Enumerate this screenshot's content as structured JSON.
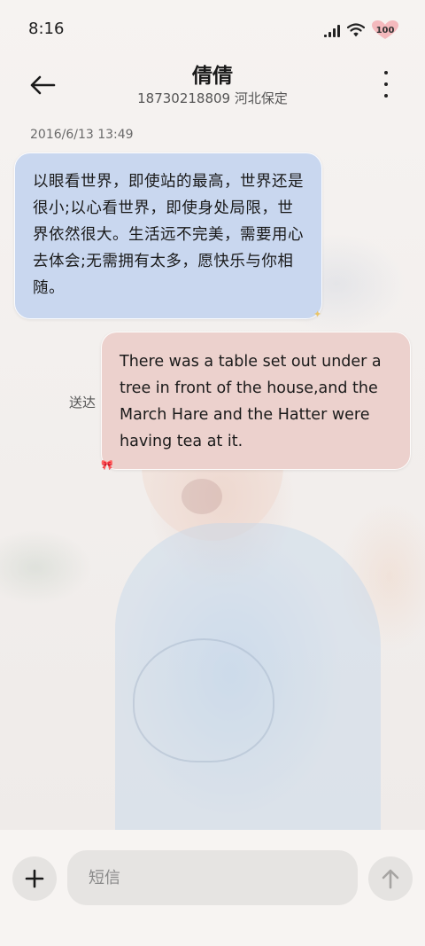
{
  "status_bar": {
    "time": "8:16",
    "battery": "100",
    "icons": [
      "signal-icon",
      "wifi-icon",
      "battery-icon"
    ]
  },
  "header": {
    "contact_name": "倩倩",
    "contact_info": "18730218809 河北保定",
    "back_icon": "arrow-left-icon",
    "more_icon": "vertical-dots-icon"
  },
  "conversation": {
    "timestamp": "2016/6/13 13:49",
    "messages": [
      {
        "direction": "incoming",
        "text": "以眼看世界，即使站的最高，世界还是很小;以心看世界，即使身处局限，世界依然很大。生活远不完美，需要用心去体会;无需拥有太多，愿快乐与你相随。",
        "bubble_color": "#c9d7ef"
      },
      {
        "direction": "outgoing",
        "text": "There was a table set out under a tree in front of the house,and the March Hare and the Hatter were having tea at it.",
        "status": "送达",
        "bubble_color": "#ecd1cd"
      }
    ]
  },
  "composer": {
    "placeholder": "短信",
    "value": "",
    "add_icon": "plus-icon",
    "send_icon": "arrow-up-icon"
  }
}
